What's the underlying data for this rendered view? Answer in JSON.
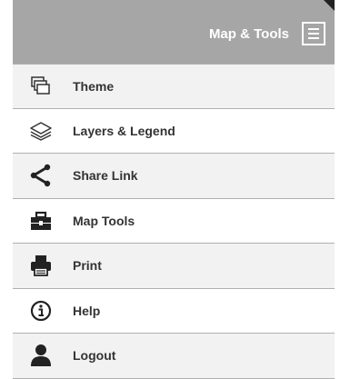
{
  "header": {
    "title": "Map & Tools",
    "menu_icon": "hamburger-menu-icon"
  },
  "menu": {
    "items": [
      {
        "label": "Theme",
        "icon": "theme-icon"
      },
      {
        "label": "Layers & Legend",
        "icon": "layers-icon"
      },
      {
        "label": "Share Link",
        "icon": "share-icon"
      },
      {
        "label": "Map Tools",
        "icon": "toolbox-icon"
      },
      {
        "label": "Print",
        "icon": "printer-icon"
      },
      {
        "label": "Help",
        "icon": "info-icon"
      },
      {
        "label": "Logout",
        "icon": "user-icon"
      }
    ]
  },
  "colors": {
    "header_bg": "#a6a6a6",
    "text": "#333333",
    "icon": "#333333"
  }
}
